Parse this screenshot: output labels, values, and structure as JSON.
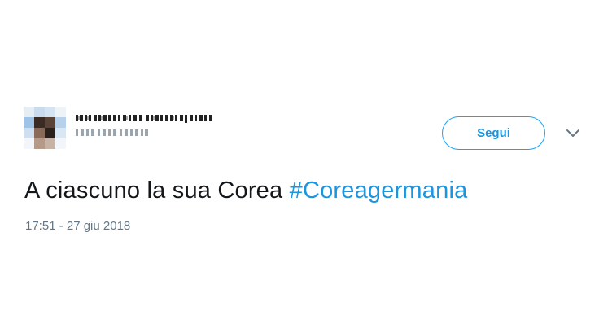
{
  "tweet": {
    "follow_label": "Segui",
    "text_plain": "A ciascuno la sua Corea ",
    "hashtag": "#Coreagermania",
    "timestamp": "17:51 - 27 giu 2018"
  },
  "icons": {
    "avatar": "avatar-image-pixelated",
    "caret": "chevron-down-icon"
  },
  "colors": {
    "link": "#1b95e0",
    "text": "#14171a",
    "muted": "#657786",
    "button_border": "#1da1f2"
  }
}
